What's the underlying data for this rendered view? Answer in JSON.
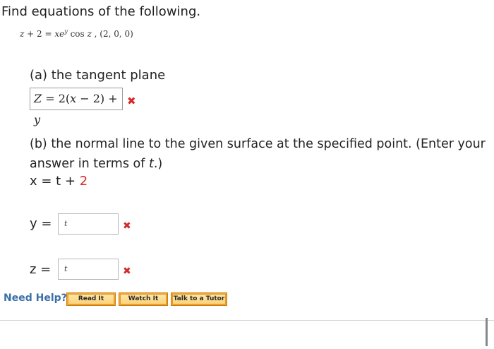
{
  "question": {
    "title": "Find equations of the following.",
    "equation": {
      "lhs_var": "z",
      "lhs_rest": " + 2 = ",
      "x": "x",
      "e": "e",
      "exp": "y",
      "cos": " cos ",
      "z": "z",
      "point": " ,  (2, 0, 0)"
    }
  },
  "part_a": {
    "label": "(a) the tangent plane",
    "answer": {
      "z": "Z",
      "rest": " = 2(",
      "x": "x",
      "rest2": " − 2) + ",
      "y": "y"
    },
    "status": "✖"
  },
  "part_b": {
    "text1": "(b) the normal line to the given surface at the specified point. (Enter your answer in terms of ",
    "t": "t",
    "text2": ".)",
    "x_prefix": "x = t + ",
    "x_value": "2",
    "y_label": "y  =",
    "y_value": "t",
    "y_status": "✖",
    "z_label": "z  =",
    "z_value": "t",
    "z_status": "✖"
  },
  "help": {
    "label": "Need Help?",
    "buttons": [
      "Read It",
      "Watch It",
      "Talk to a Tutor"
    ]
  }
}
